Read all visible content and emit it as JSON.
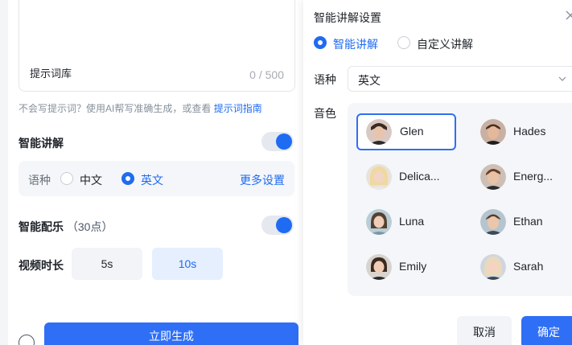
{
  "left": {
    "lexicon_label": "提示词库",
    "char_count": "0 / 500",
    "hint_text": "不会写提示词？使用AI帮写准确生成，或查看 ",
    "hint_link": "提示词指南",
    "smart_narration": {
      "title": "智能讲解",
      "enabled": true
    },
    "language": {
      "label": "语种",
      "options": [
        "中文",
        "英文"
      ],
      "selected": "英文",
      "more": "更多设置"
    },
    "smart_music": {
      "title": "智能配乐",
      "points": "（30点）",
      "enabled": true
    },
    "duration": {
      "title": "视频时长",
      "options": [
        "5s",
        "10s"
      ],
      "selected": "10s"
    },
    "generate_label": "立即生成"
  },
  "popup": {
    "title": "智能讲解设置",
    "modes": [
      "智能讲解",
      "自定义讲解"
    ],
    "selected_mode": "智能讲解",
    "language_label": "语种",
    "language_value": "英文",
    "voice_label": "音色",
    "voices": [
      "Glen",
      "Hades",
      "Delica...",
      "Energ...",
      "Luna",
      "Ethan",
      "Emily",
      "Sarah"
    ],
    "selected_voice": "Glen",
    "cancel_label": "取消",
    "ok_label": "确定"
  },
  "colors": {
    "accent": "#1f6bf2",
    "panel_bg": "#f4f6f9"
  }
}
